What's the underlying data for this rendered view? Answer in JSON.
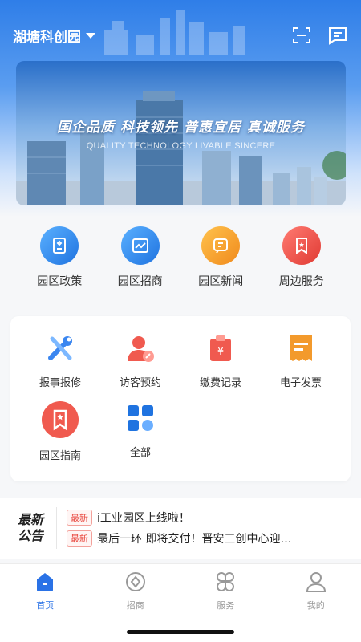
{
  "header": {
    "park_name": "湖塘科创园",
    "icons": [
      "scan-icon",
      "message-icon"
    ]
  },
  "banner": {
    "slogan": "国企品质 科技领先 普惠宜居 真诚服务",
    "subtitle": "QUALITY TECHNOLOGY LIVABLE SINCERE"
  },
  "quick_nav": {
    "items": [
      {
        "label": "园区政策",
        "icon": "policy-icon",
        "color": "#2f8cf0"
      },
      {
        "label": "园区招商",
        "icon": "chart-icon",
        "color": "#2f8cf0"
      },
      {
        "label": "园区新闻",
        "icon": "news-icon",
        "color": "#f2a02b"
      },
      {
        "label": "周边服务",
        "icon": "bookmark-icon",
        "color": "#e8453c"
      }
    ]
  },
  "services": {
    "items": [
      {
        "label": "报事报修",
        "icon": "repair-icon"
      },
      {
        "label": "访客预约",
        "icon": "visitor-icon"
      },
      {
        "label": "缴费记录",
        "icon": "payment-icon"
      },
      {
        "label": "电子发票",
        "icon": "invoice-icon"
      },
      {
        "label": "园区指南",
        "icon": "guide-icon"
      },
      {
        "label": "全部",
        "icon": "all-icon"
      }
    ]
  },
  "notice": {
    "logo_line1": "最新",
    "logo_line2": "公告",
    "items": [
      {
        "badge": "最新",
        "text": "i工业园区上线啦！"
      },
      {
        "badge": "最新",
        "text": "最后一环 即将交付！晋安三创中心迎…"
      }
    ]
  },
  "tabbar": {
    "items": [
      {
        "label": "首页",
        "active": true
      },
      {
        "label": "招商",
        "active": false
      },
      {
        "label": "服务",
        "active": false
      },
      {
        "label": "我的",
        "active": false
      }
    ]
  },
  "colors": {
    "primary": "#2a72e6",
    "accent_red": "#e8453c",
    "accent_orange": "#f2a02b"
  }
}
